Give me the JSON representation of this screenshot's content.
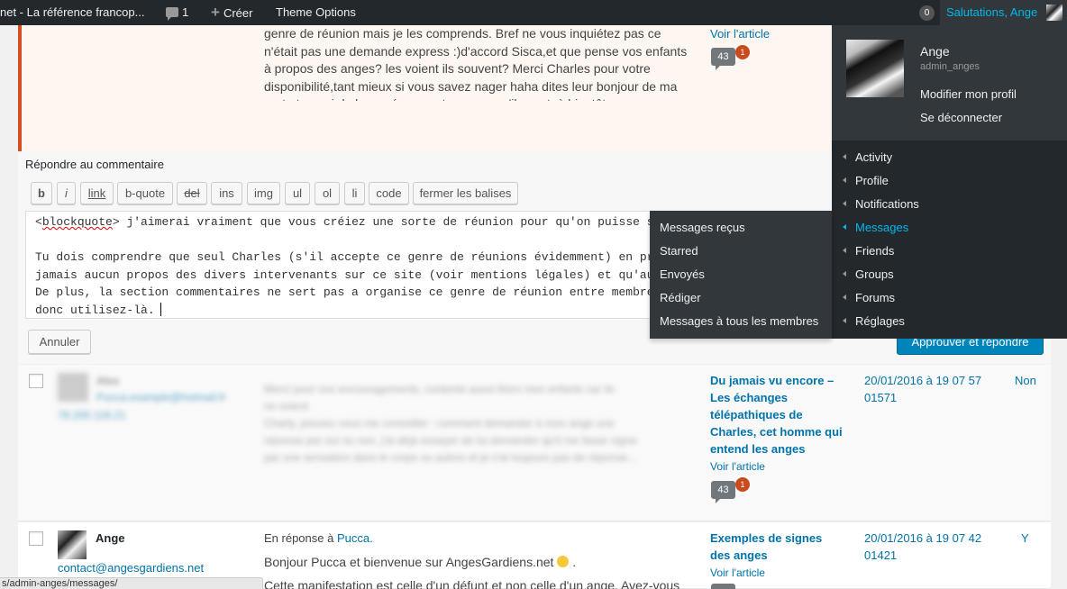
{
  "adminbar": {
    "site_name": "net - La référence francop...",
    "comments_count": "1",
    "create_label": "Créer",
    "theme_options_label": "Theme Options",
    "notification_count": "0",
    "greeting": "Salutations, Ange"
  },
  "highlighted_comment": {
    "text": "genre de réunion mais je les comprends. Bref ne vous inquiétez pas ce n'était pas une demande express :)d'accord Sisca,et que pense vos enfants à propos des anges? les voient ils souvent? Merci Charles pour votre disponibilité,tant mieux si vous savez nager haha dites leur bonjour de ma part et merci de leur présence et pour ce qu'ils sont. à bientôt",
    "view_post_label": "Voir l'article",
    "comment_count": "43",
    "pending_count": "1"
  },
  "reply": {
    "title": "Répondre au commentaire",
    "quicktags": [
      "b",
      "i",
      "link",
      "b-quote",
      "del",
      "ins",
      "img",
      "ul",
      "ol",
      "li",
      "code",
      "fermer les balises"
    ],
    "text_open_tag": "blockquote",
    "text_line1_rest": " j'aimerai vraiment que vous créiez une sorte de réunion pour qu'on puisse se réuni",
    "text_line2": "Tu dois comprendre que seul Charles (s'il accepte ce genre de réunions évidemment) en prend la r",
    "text_line3": "jamais aucun propos des divers intervenants sur ce site (voir mentions légales) et qu'aucun inte",
    "text_line4": "De plus, la section commentaires ne sert pas a organise ce genre de réunion entre membres. Vous",
    "text_line5": "donc utilisez-là.",
    "cancel_label": "Annuler",
    "approve_label": "Approuver et répondre"
  },
  "comments": [
    {
      "author": "Alex",
      "email": "Pucca.example@hotmail.fr",
      "ip": "78.200.116.21",
      "text_line1": "Merci pour vos encouragements, contente aussi Alors mes enfants car ils",
      "text_line2": "ne voient",
      "text_line3": "Charly, pouvez vous me conseiller : comment demander à mon ange une",
      "text_line4": "réponse par oui ou non, j'ai déjà essayer de lui demander qu'il me fasse signe",
      "text_line5": "par une sensation dans le corps ou autres et je n'ai toujours pas de réponse...",
      "post_title": "Du jamais vu encore – Les échanges télépathiques de Charles, cet homme qui entend les anges",
      "view_post_label": "Voir l'article",
      "comment_count": "43",
      "pending_count": "1",
      "date": "20/01/2016 à 19 07 57 01571",
      "flag": "Non"
    },
    {
      "author": "Ange",
      "email": "contact@angesgardiens.net",
      "in_reply_prefix": "En réponse à",
      "in_reply_name": "Pucca.",
      "body": "Bonjour Pucca et bienvenue sur AngesGardiens.net",
      "body_suffix": " .",
      "body2": "Cette manifestation est celle d'un défunt et non celle d'un ange. Avez-vous",
      "post_title": "Exemples de signes des anges",
      "view_post_label": "Voir l'article",
      "date": "20/01/2016 à 19 07 42 01421",
      "flag": "Y"
    }
  ],
  "status_url": "s/admin-anges/messages/",
  "account_menu": {
    "display_name": "Ange",
    "username": "admin_anges",
    "edit_profile": "Modifier mon profil",
    "logout": "Se déconnecter",
    "items": [
      "Activity",
      "Profile",
      "Notifications",
      "Messages",
      "Friends",
      "Groups",
      "Forums",
      "Réglages"
    ],
    "messages_submenu": [
      "Messages reçus",
      "Starred",
      "Envoyés",
      "Rédiger",
      "Messages à tous les membres"
    ]
  },
  "colors": {
    "accent": "#0073aa",
    "active_menu": "#00b9eb",
    "admin_bar": "#23282d",
    "pending_bubble": "#ca4a1f"
  }
}
